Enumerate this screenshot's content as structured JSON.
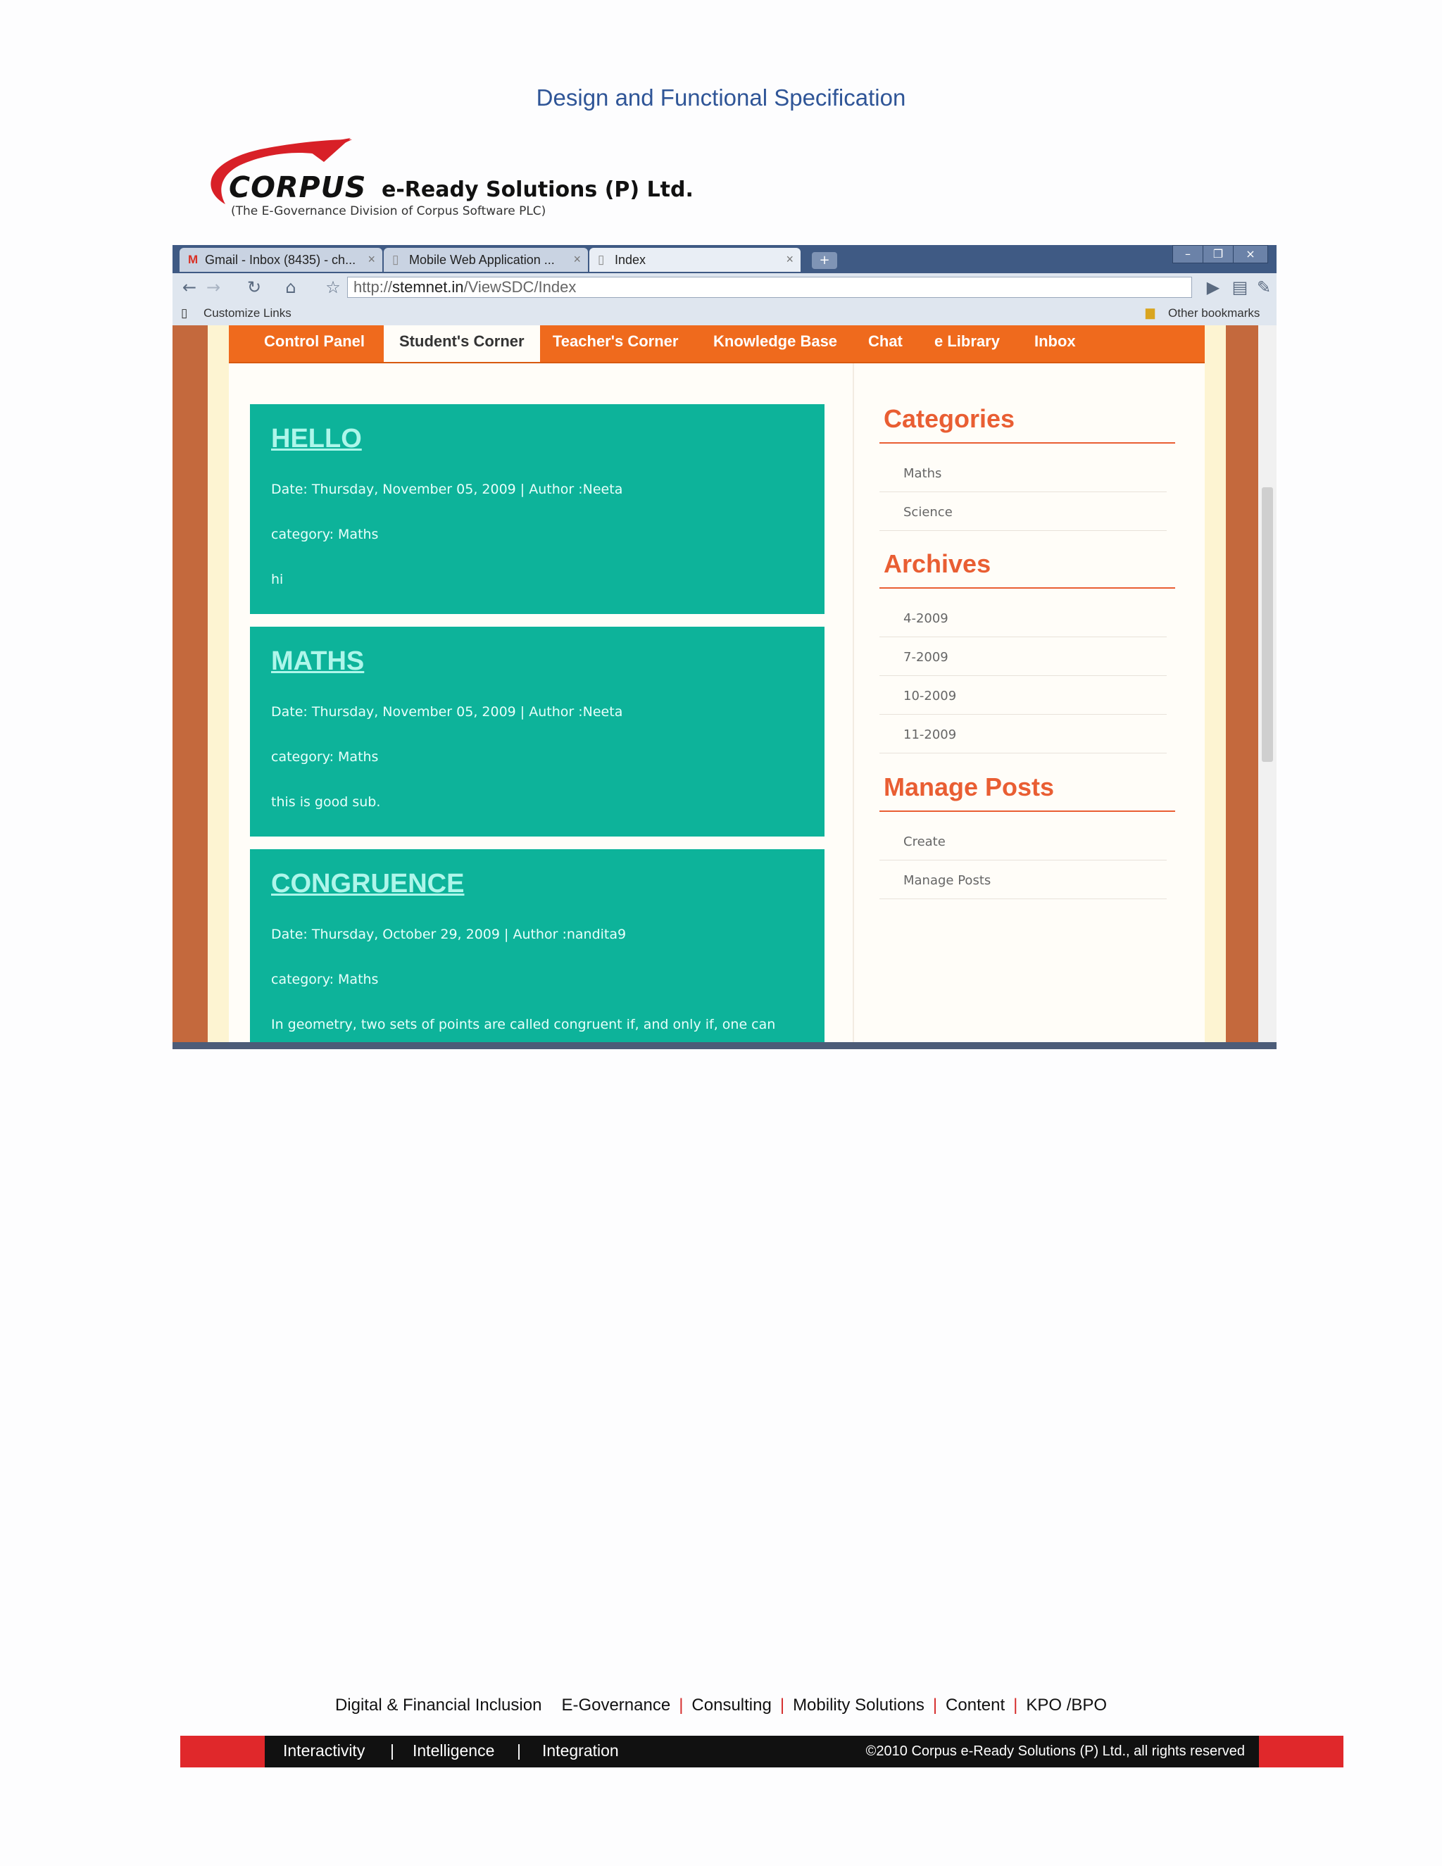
{
  "document": {
    "title": "Design and Functional Specification"
  },
  "logo": {
    "name": "CORPUS",
    "company": "e-Ready Solutions (P) Ltd.",
    "tagline": "(The E-Governance Division of Corpus Software PLC)"
  },
  "browser": {
    "tabs": [
      {
        "label": "Gmail - Inbox (8435) - ch...",
        "icon": "gmail-icon"
      },
      {
        "label": "Mobile Web Application ...",
        "icon": "page-icon"
      },
      {
        "label": "Index",
        "icon": "page-icon"
      }
    ],
    "address": {
      "prefix": "http://",
      "host": "stemnet.in",
      "path": "/ViewSDC/Index"
    },
    "bookmarks": {
      "left": "Customize Links",
      "right": "Other bookmarks"
    }
  },
  "site": {
    "nav": [
      {
        "label": "Control Panel"
      },
      {
        "label": "Student's Corner",
        "active": true
      },
      {
        "label": "Teacher's Corner"
      },
      {
        "label": "Knowledge Base"
      },
      {
        "label": "Chat"
      },
      {
        "label": "e Library"
      },
      {
        "label": "Inbox"
      }
    ],
    "posts": [
      {
        "title": "HELLO",
        "meta": "Date: Thursday, November 05, 2009  |  Author :Neeta",
        "category": "category: Maths",
        "body": "hi"
      },
      {
        "title": "MATHS",
        "meta": "Date: Thursday, November 05, 2009  |  Author :Neeta",
        "category": "category: Maths",
        "body": "this is good sub."
      },
      {
        "title": "CONGRUENCE",
        "meta": "Date: Thursday, October 29, 2009  |  Author :nandita9",
        "category": "category: Maths",
        "body": "In geometry, two sets of points are called congruent if, and only if, one can"
      }
    ],
    "sidebar": {
      "categories": {
        "heading": "Categories",
        "items": [
          "Maths",
          "Science"
        ]
      },
      "archives": {
        "heading": "Archives",
        "items": [
          "4-2009",
          "7-2009",
          "10-2009",
          "11-2009"
        ]
      },
      "manage": {
        "heading": "Manage Posts",
        "items": [
          "Create",
          "Manage Posts"
        ]
      }
    }
  },
  "footer": {
    "links": [
      "Digital & Financial Inclusion",
      "E-Governance",
      "Consulting",
      "Mobility Solutions",
      "Content",
      "KPO /BPO"
    ],
    "taglines": [
      "Interactivity",
      "Intelligence",
      "Integration"
    ],
    "copyright": "©2010 Corpus e-Ready Solutions (P) Ltd., all rights reserved"
  },
  "colors": {
    "accent": "#ef6a1d",
    "post_bg": "#0db39a",
    "sidebar_heading": "#e95e33",
    "doc_title": "#2f5597"
  }
}
